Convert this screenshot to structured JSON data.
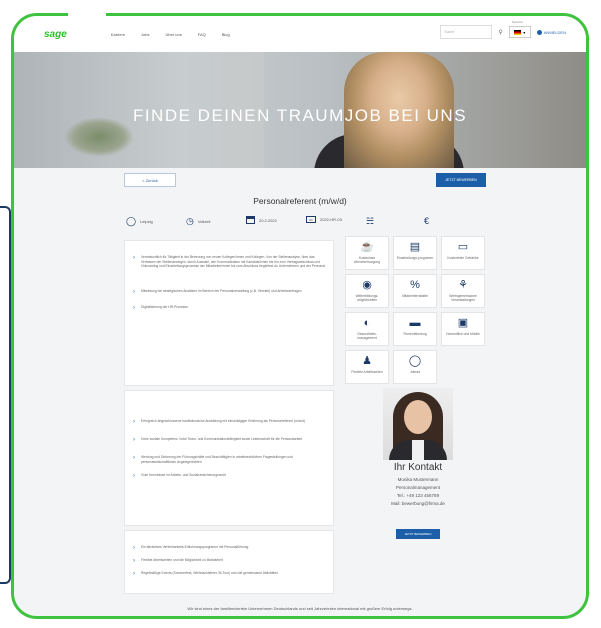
{
  "nav": {
    "logo": "sage",
    "menu": [
      "Karriere",
      "Jobs",
      "Über uns",
      "FAQ",
      "Blog"
    ],
    "search_placeholder": "Suche",
    "language": "DE",
    "language_top": "Sprache",
    "login": "ANMELDEN"
  },
  "hero": {
    "title": "FINDE DEINEN TRAUMJOB BEI UNS"
  },
  "actions": {
    "back": "< Zurück",
    "apply": "JETZT BEWERBEN",
    "apply2": "JETZT BEWERBEN"
  },
  "job": {
    "title": "Personalreferent (m/w/d)",
    "location": "Leipzig",
    "type": "Vollzeit",
    "date": "20.2.2022",
    "id": "2022-HR-03"
  },
  "tasks": [
    "Verantwortlich für Tätigkeit in der Betreuung von neuen Kollegen/innen und Kollegen. Von der Stellenanalyse, über das Verfassen der Stellenanzeigen, durch Auswahl, den Kommunikation mit Kandidat/innen bis hin zum Vertragsabschluss und Onboarding und Einarbeitungsprozesse der Mitarbeiter/innen bis zum Abschluss begleitest du Unternehmen und der Personal.",
    "Mitwirkung bei strategischen Ansätzen im Bereich der Personalverwaltung (z.B. Vertrieb) und Arbeitsumfragen",
    "Digitalisierung der HR-Prozesse"
  ],
  "qualifications": [
    "Erfolgreich abgeschlossene kaufmännische Ausbildung mit einschlägiger Erfahrung als Personalreferent (m/w/d)",
    "Hohe soziale Kompetenz, hohe Team- und Kommunikationsfähigkeit sowie Leidenschaft für die Personalarbeit",
    "Wertung und Sicherung der Führungskräfte und Beschäftigten in arbeitsrechtlichen Fragestellungen und personalwirtschaftlichen Angelegenheiten",
    "Gute Kenntnisse im Arbeits- und Sozialversicherungsrecht"
  ],
  "offers": [
    "Ein attraktives Vereinbarkeits-Entlohnungsprogramm mit Personalführung",
    "Flexible Arbeitszeiten und die Möglichkeit zu Mobilarbeit",
    "Regelmäßige Events (Sommerfest, Weihnachtsfeier, Bi-Tour) und viel gemeinsame Aktivitäten"
  ],
  "benefits": [
    {
      "icon": "coffee-icon",
      "label": "Kostenlose Abendversorgung"
    },
    {
      "icon": "gift-icon",
      "label": "Einarbeitungs-programm"
    },
    {
      "icon": "bottle-icon",
      "label": "Kostenfreie Getränke"
    },
    {
      "icon": "badge-icon",
      "label": "Weiterbildungs-möglichkeiten"
    },
    {
      "icon": "percent-icon",
      "label": "Mitarbeiterrabatte"
    },
    {
      "icon": "plant-icon",
      "label": "Wertsgemeinsame Veranstaltungen"
    },
    {
      "icon": "piggy-icon",
      "label": "Gesundheits-management"
    },
    {
      "icon": "car-icon",
      "label": "Firmenfahrzeug"
    },
    {
      "icon": "laptop-icon",
      "label": "Homeoffice und Mobile"
    },
    {
      "icon": "people-icon",
      "label": "Flexible Arbeitszeiten"
    },
    {
      "icon": "bike-icon",
      "label": "Jobrad"
    }
  ],
  "contact": {
    "heading": "Ihr Kontakt",
    "name": "Monika Mustermann",
    "department": "Personalmanagement",
    "phone": "Tel.: +49 123 456789",
    "email": "Mail: bewerbung@firma.de"
  },
  "footer": "Wir sind eines der familienvierteln Unternehmen Deutschlands und seit Jahrzehnten international mit großem Erfolg unterwegs."
}
